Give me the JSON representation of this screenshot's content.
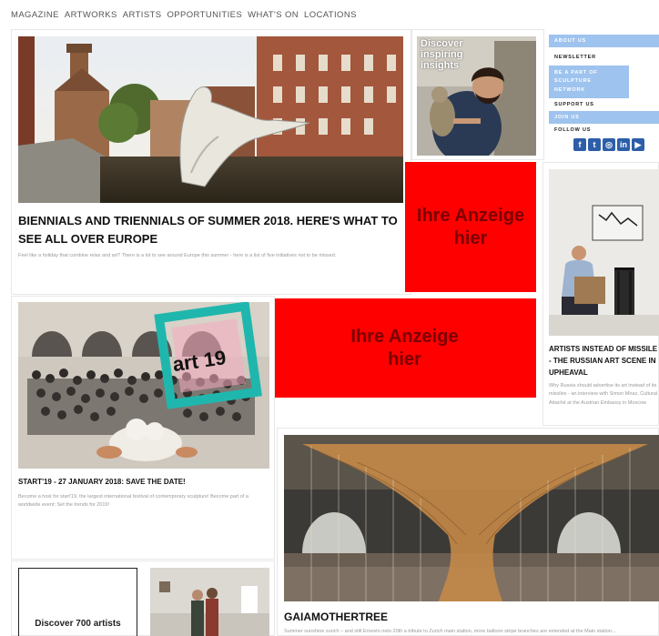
{
  "nav": [
    "MAGAZINE",
    "ARTWORKS",
    "ARTISTS",
    "OPPORTUNITIES",
    "WHAT'S ON",
    "LOCATIONS"
  ],
  "article1": {
    "title": "BIENNIALS AND TRIENNIALS OF SUMMER 2018. HERE'S WHAT TO SEE ALL OVER EUROPE",
    "excerpt": "Feel like a holiday that combine relax and art? There is a lot to see around Europe this summer - here is a list of five initiatives not to be missed."
  },
  "promo": {
    "text": "Discover inspiring insights"
  },
  "ads": [
    "Ihre Anzeige hier",
    "Ihre Anzeige hier"
  ],
  "sidebar": {
    "items": [
      "ABOUT US",
      "NEWSLETTER",
      "BE A PART OF SCULPTURE NETWORK",
      "SUPPORT US",
      "JOIN US",
      "FOLLOW US"
    ],
    "social": [
      "f",
      "t",
      "◎",
      "in",
      "▶"
    ]
  },
  "article2": {
    "title": "ARTISTS INSTEAD OF MISSILE - THE RUSSIAN ART SCENE IN UPHEAVAL",
    "excerpt": "Why Russia should advertise its art instead of its missiles - an interview with Simon Miraz, Cultural Attaché at the Austrian Embassy in Moscow"
  },
  "article3": {
    "title": "START'19 - 27 JANUARY 2018: SAVE THE DATE!",
    "excerpt": "Become a host for start'19, the largest international festival of contemporary sculpture! Become part of a worldwide event: Set the trends for 2019!",
    "logo_text": "art 19"
  },
  "article4": {
    "title": "GAIAMOTHERTREE",
    "excerpt": "Summer sunshine zurich – and still Ernesto neto 20th a tribute to Zurich main station, more balloon stripe branches are extended at the Main station..."
  },
  "discover": {
    "label": "Discover 700 artists"
  },
  "colors": {
    "ad": "#ff0000",
    "ad_text": "#7a0000",
    "sidebar_highlight": "#9ec3ee",
    "social": "#2d5fa8"
  }
}
